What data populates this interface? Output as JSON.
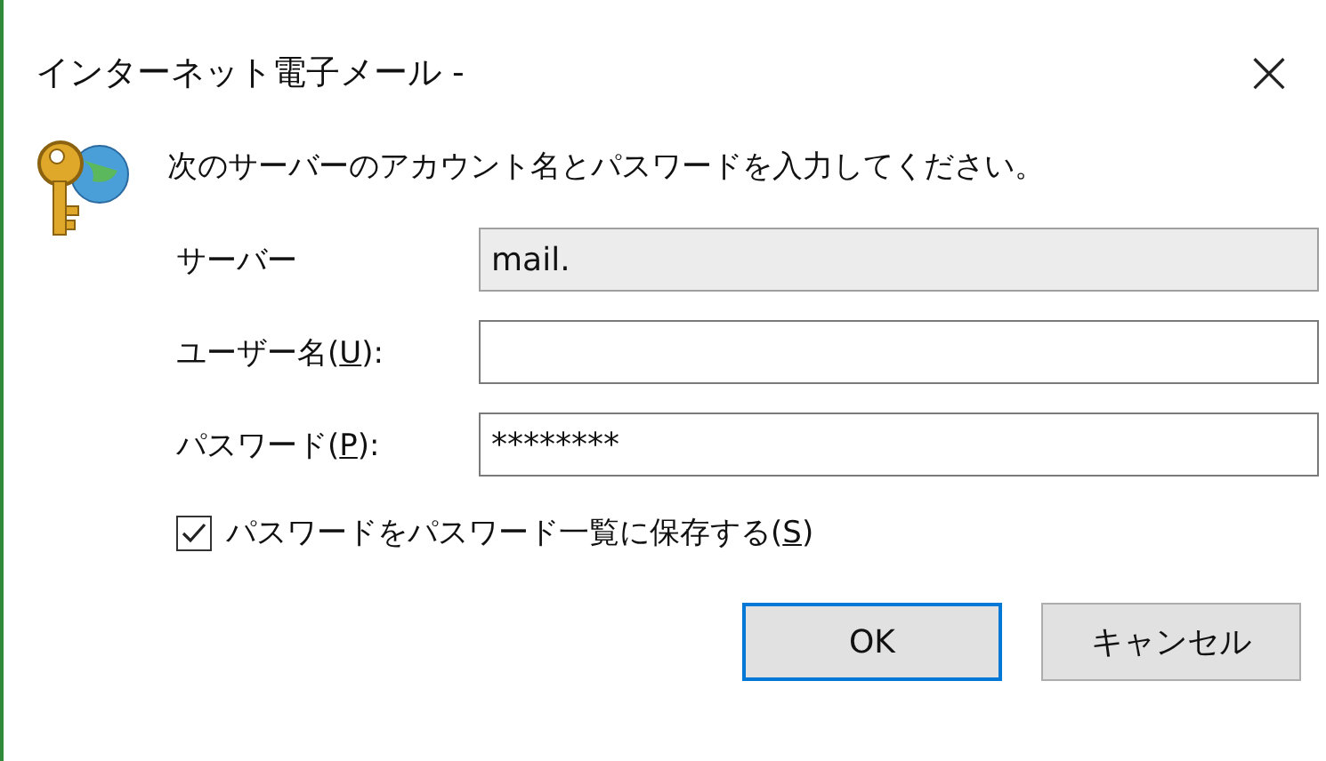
{
  "window": {
    "title": "インターネット電子メール -",
    "close": "×"
  },
  "message": "次のサーバーのアカウント名とパスワードを入力してください。",
  "fields": [
    {
      "label_parts": [
        "サーバー"
      ],
      "value": "mail.",
      "disabled": true
    },
    {
      "label_parts": [
        "ユーザー名(",
        "U",
        "):"
      ],
      "disabled": false
    },
    {
      "label_parts": [
        "パスワード(",
        "P",
        "):"
      ],
      "value": "********",
      "disabled": false
    }
  ],
  "save_password": {
    "label_parts": [
      "パスワードをパスワード一覧に保存する(",
      "S",
      ")"
    ],
    "checked": true
  },
  "buttons": [
    {
      "label": "OK",
      "selected": true
    },
    {
      "label": "キャンセル",
      "selected": false
    }
  ]
}
